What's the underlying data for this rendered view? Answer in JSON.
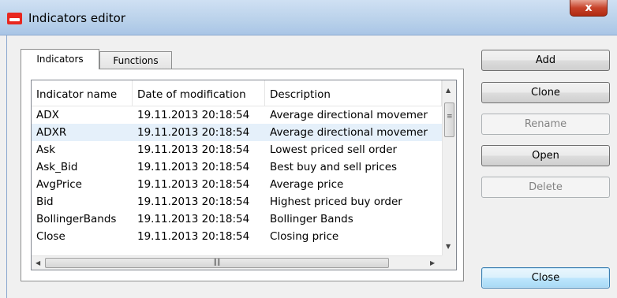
{
  "window": {
    "title": "Indicators editor",
    "close_glyph": "x"
  },
  "tabs": [
    {
      "label": "Indicators",
      "active": true
    },
    {
      "label": "Functions",
      "active": false
    }
  ],
  "table": {
    "columns": [
      "Indicator name",
      "Date of modification",
      "Description"
    ],
    "rows": [
      {
        "name": "ADX",
        "date": "19.11.2013 20:18:54",
        "description": "Average directional movemer",
        "selected": false
      },
      {
        "name": "ADXR",
        "date": "19.11.2013 20:18:54",
        "description": "Average directional movemer",
        "selected": true
      },
      {
        "name": "Ask",
        "date": "19.11.2013 20:18:54",
        "description": "Lowest priced sell order",
        "selected": false
      },
      {
        "name": "Ask_Bid",
        "date": "19.11.2013 20:18:54",
        "description": "Best buy and sell prices",
        "selected": false
      },
      {
        "name": "AvgPrice",
        "date": "19.11.2013 20:18:54",
        "description": "Average price",
        "selected": false
      },
      {
        "name": "Bid",
        "date": "19.11.2013 20:18:54",
        "description": "Highest priced buy order",
        "selected": false
      },
      {
        "name": "BollingerBands",
        "date": "19.11.2013 20:18:54",
        "description": "Bollinger Bands",
        "selected": false
      },
      {
        "name": "Close",
        "date": "19.11.2013 20:18:54",
        "description": "Closing price",
        "selected": false
      }
    ]
  },
  "buttons": {
    "add": "Add",
    "clone": "Clone",
    "rename": "Rename",
    "open": "Open",
    "delete": "Delete",
    "close": "Close"
  },
  "icons": {
    "app": "app-logo-icon",
    "scroll_up": "scroll-up-arrow-icon",
    "scroll_down": "scroll-down-arrow-icon",
    "scroll_left": "scroll-left-arrow-icon",
    "scroll_right": "scroll-right-arrow-icon"
  },
  "colors": {
    "titlebar": "#b9d1ea",
    "close_button": "#c7432a",
    "selected_row": "#e5f0fa",
    "default_button": "#bee6fd"
  }
}
